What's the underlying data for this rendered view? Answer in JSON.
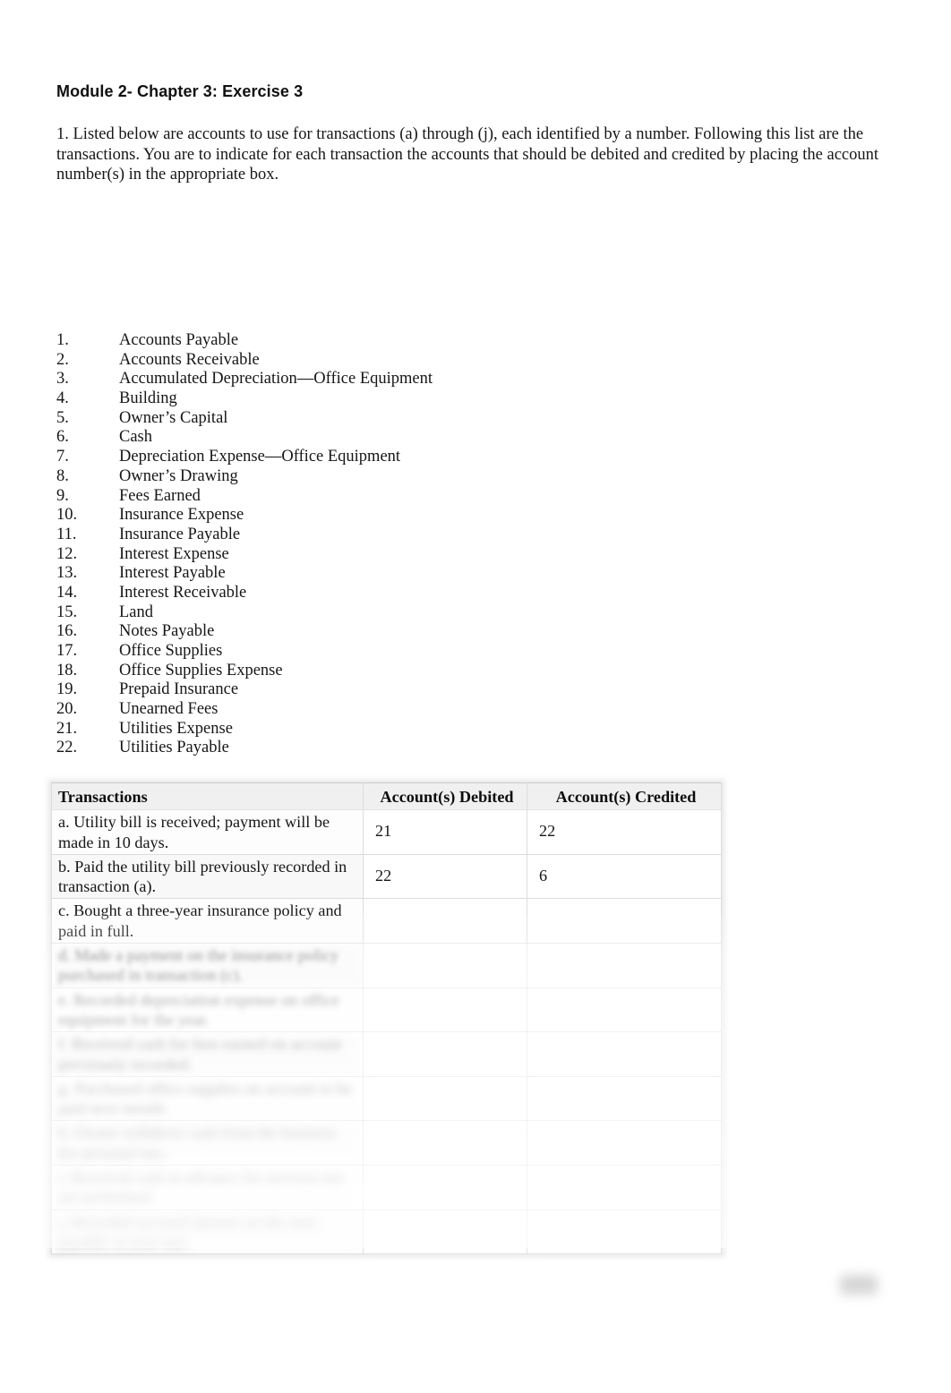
{
  "document": {
    "title": "Module 2- Chapter 3: Exercise 3",
    "intro": "1. Listed below are accounts to use for transactions (a) through (j), each identified by a number. Following this list are the transactions. You are to indicate for each transaction the accounts that should be debited and credited by placing the account number(s) in the appropriate box."
  },
  "accounts": [
    {
      "num": "1.",
      "label": "Accounts Payable"
    },
    {
      "num": "2.",
      "label": "Accounts Receivable"
    },
    {
      "num": "3.",
      "label": "Accumulated Depreciation—Office Equipment"
    },
    {
      "num": "4.",
      "label": "Building"
    },
    {
      "num": "5.",
      "label": "Owner’s Capital"
    },
    {
      "num": "6.",
      "label": "Cash"
    },
    {
      "num": "7.",
      "label": "Depreciation Expense—Office Equipment"
    },
    {
      "num": "8.",
      "label": "Owner’s Drawing"
    },
    {
      "num": "9.",
      "label": "Fees Earned"
    },
    {
      "num": "10.",
      "label": "Insurance Expense"
    },
    {
      "num": "11.",
      "label": "Insurance Payable"
    },
    {
      "num": "12.",
      "label": "Interest Expense"
    },
    {
      "num": "13.",
      "label": "Interest Payable"
    },
    {
      "num": "14.",
      "label": "Interest Receivable"
    },
    {
      "num": "15.",
      "label": "Land"
    },
    {
      "num": "16.",
      "label": "Notes Payable"
    },
    {
      "num": "17.",
      "label": "Office Supplies"
    },
    {
      "num": "18.",
      "label": "Office Supplies Expense"
    },
    {
      "num": "19.",
      "label": "Prepaid Insurance"
    },
    {
      "num": "20.",
      "label": "Unearned Fees"
    },
    {
      "num": "21.",
      "label": "Utilities Expense"
    },
    {
      "num": "22.",
      "label": "Utilities Payable"
    }
  ],
  "worksheet": {
    "headers": {
      "transactions": "Transactions",
      "debited": "Account(s) Debited",
      "credited": "Account(s) Credited"
    },
    "rows": [
      {
        "description": "a. Utility bill is received; payment will be made in 10 days.",
        "debited": "21",
        "credited": "22",
        "blur": 0
      },
      {
        "description": "b. Paid the utility bill previously recorded in transaction (a).",
        "debited": "22",
        "credited": "6",
        "blur": 0
      },
      {
        "description": "c. Bought a three-year insurance policy and paid in full.",
        "debited": "",
        "credited": "",
        "blur": 0
      },
      {
        "description": "d. Made a payment on the insurance policy purchased in transaction (c).",
        "debited": "",
        "credited": "",
        "blur": 1
      },
      {
        "description": "e. Recorded depreciation expense on office equipment for the year.",
        "debited": "",
        "credited": "",
        "blur": 2
      },
      {
        "description": "f. Received cash for fees earned on account previously recorded.",
        "debited": "",
        "credited": "",
        "blur": 3
      },
      {
        "description": "g. Purchased office supplies on account to be paid next month.",
        "debited": "",
        "credited": "",
        "blur": 4
      },
      {
        "description": "h. Owner withdrew cash from the business for personal use.",
        "debited": "",
        "credited": "",
        "blur": 5
      },
      {
        "description": "i. Received cash in advance for services not yet performed.",
        "debited": "",
        "credited": "",
        "blur": 6
      },
      {
        "description": "j. Recorded accrued interest on the note payable at year end.",
        "debited": "",
        "credited": "",
        "blur": 7
      }
    ]
  }
}
